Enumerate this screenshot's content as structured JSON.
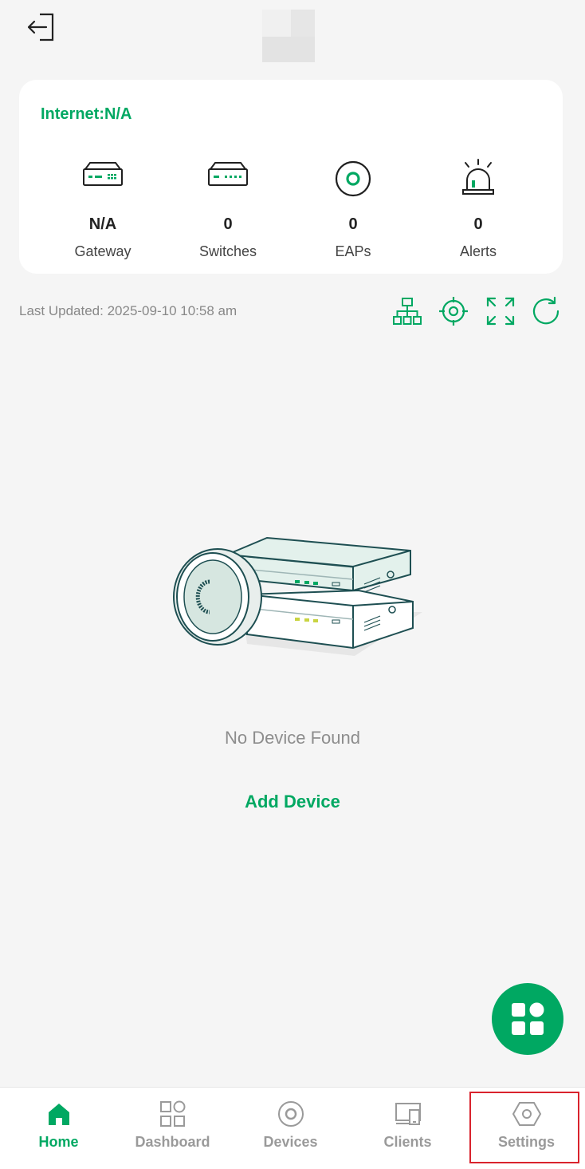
{
  "header": {
    "back_icon": "logout-icon"
  },
  "summary": {
    "internet_label": "Internet:N/A",
    "stats": [
      {
        "icon": "gateway-icon",
        "value": "N/A",
        "label": "Gateway"
      },
      {
        "icon": "switch-icon",
        "value": "0",
        "label": "Switches"
      },
      {
        "icon": "eap-icon",
        "value": "0",
        "label": "EAPs"
      },
      {
        "icon": "alert-siren-icon",
        "value": "0",
        "label": "Alerts"
      }
    ]
  },
  "status": {
    "last_updated": "Last Updated: 2025-09-10 10:58 am",
    "tools": [
      "topology-icon",
      "locate-icon",
      "fullscreen-icon",
      "refresh-icon"
    ]
  },
  "empty_state": {
    "message": "No Device Found",
    "action": "Add Device"
  },
  "fab": {
    "icon": "apps-grid-icon"
  },
  "nav": {
    "items": [
      {
        "label": "Home",
        "icon": "home-icon",
        "active": true
      },
      {
        "label": "Dashboard",
        "icon": "dashboard-icon",
        "active": false
      },
      {
        "label": "Devices",
        "icon": "devices-icon",
        "active": false
      },
      {
        "label": "Clients",
        "icon": "clients-icon",
        "active": false
      },
      {
        "label": "Settings",
        "icon": "settings-icon",
        "active": false
      }
    ]
  },
  "colors": {
    "accent": "#00a862",
    "background": "#f5f5f5",
    "highlight": "#d9232d"
  }
}
